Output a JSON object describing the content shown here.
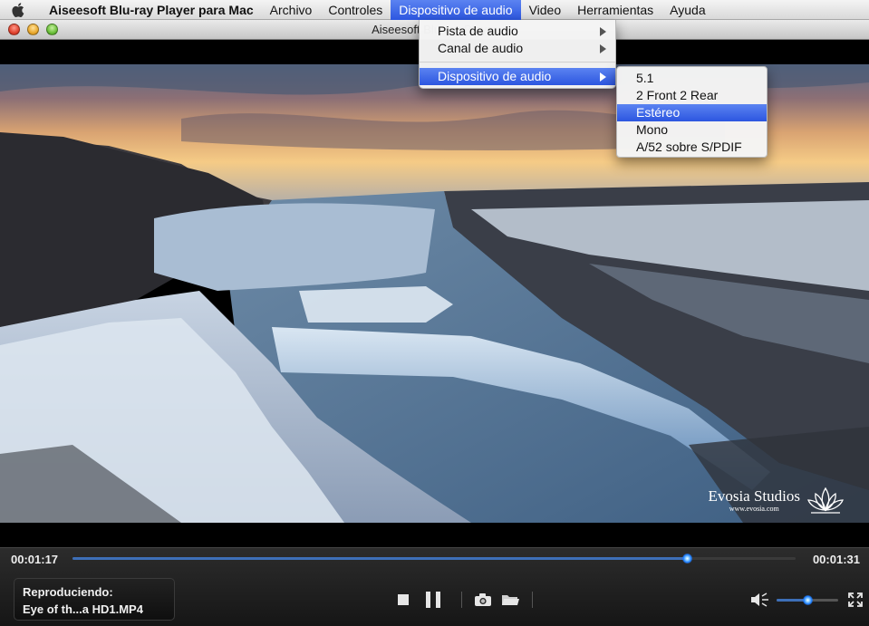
{
  "menubar": {
    "app_name": "Aiseesoft Blu-ray Player para Mac",
    "items": [
      "Archivo",
      "Controles",
      "Dispositivo de audio",
      "Video",
      "Herramientas",
      "Ayuda"
    ]
  },
  "window": {
    "title": "Aiseesoft Blu-ray Player"
  },
  "audio_menu": {
    "items": [
      "Pista de audio",
      "Canal de audio",
      "Dispositivo de audio"
    ],
    "submenu": [
      "5.1",
      "2 Front 2 Rear",
      "Estéreo",
      "Mono",
      "A/52 sobre S/PDIF"
    ],
    "selected_submenu": "Estéreo"
  },
  "video": {
    "watermark_name": "Evosia Studios",
    "watermark_url": "www.evosia.com"
  },
  "playback": {
    "current_time": "00:01:17",
    "duration": "00:01:31",
    "progress_fraction": 0.85,
    "now_playing_label": "Reproduciendo:",
    "now_playing_file": "Eye of th...a HD1.MP4",
    "volume_fraction": 0.5
  },
  "colors": {
    "menu_highlight": "#2c56e0",
    "progress_accent": "#1e7dff"
  }
}
